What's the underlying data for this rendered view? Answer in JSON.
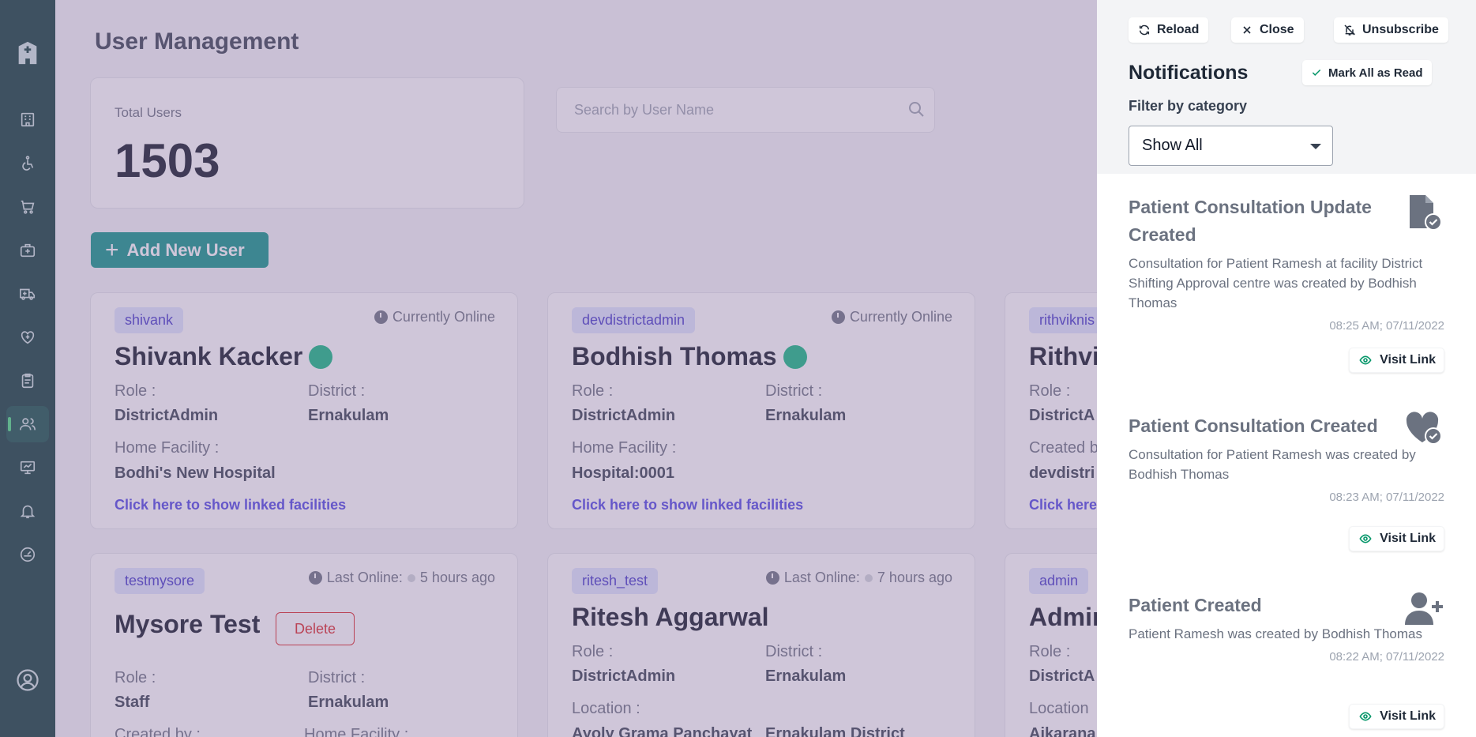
{
  "sidebar": {
    "logo": "hospital-icon",
    "items": [
      {
        "icon": "building-icon",
        "active": false
      },
      {
        "icon": "wheelchair-icon",
        "active": false
      },
      {
        "icon": "cart-icon",
        "active": false
      },
      {
        "icon": "medical-kit-icon",
        "active": false
      },
      {
        "icon": "ambulance-icon",
        "active": false
      },
      {
        "icon": "heart-plus-icon",
        "active": false
      },
      {
        "icon": "clipboard-icon",
        "active": false
      },
      {
        "icon": "users-icon",
        "active": true
      },
      {
        "icon": "monitor-icon",
        "active": false
      },
      {
        "icon": "bell-icon",
        "active": false
      },
      {
        "icon": "dashboard-icon",
        "active": false
      }
    ],
    "profile_icon": "user-circle-icon"
  },
  "main": {
    "title": "User Management",
    "total_label": "Total Users",
    "total_value": "1503",
    "search_placeholder": "Search by User Name",
    "add_button": "Add New User",
    "users": [
      {
        "username": "shivank",
        "status": "Currently Online",
        "name": "Shivank Kacker",
        "online": true,
        "role_label": "Role :",
        "role": "DistrictAdmin",
        "district_label": "District :",
        "district": "Ernakulam",
        "extra_label": "Home Facility :",
        "extra": "Bodhi's New Hospital",
        "link": "Click here to show linked facilities"
      },
      {
        "username": "devdistrictadmin",
        "status": "Currently Online",
        "name": "Bodhish Thomas",
        "online": true,
        "role_label": "Role :",
        "role": "DistrictAdmin",
        "district_label": "District :",
        "district": "Ernakulam",
        "extra_label": "Home Facility :",
        "extra": "Hospital:0001",
        "link": "Click here to show linked facilities"
      },
      {
        "username": "rithviknis",
        "name": "Rithvi",
        "role_label": "Role :",
        "role": "DistrictA",
        "extra_label": "Created b",
        "extra": "devdistri",
        "link": "Click here"
      },
      {
        "username": "testmysore",
        "status_label": "Last Online:",
        "status_time": "5 hours ago",
        "name": "Mysore Test",
        "delete_label": "Delete",
        "role_label": "Role :",
        "role": "Staff",
        "district_label": "District :",
        "district": "Ernakulam",
        "created_label": "Created by :",
        "home_label": "Home Facility :"
      },
      {
        "username": "ritesh_test",
        "status_label": "Last Online:",
        "status_time": "7 hours ago",
        "name": "Ritesh Aggarwal",
        "role_label": "Role :",
        "role": "DistrictAdmin",
        "district_label": "District :",
        "district": "Ernakulam",
        "location_label": "Location :",
        "location_a": "Ayoly  Grama Panchayat",
        "location_b": "Ernakulam District"
      },
      {
        "username": "admin",
        "name": "Admin",
        "role_label": "Role :",
        "role": "DistrictA",
        "location_label": "Location",
        "location_a": "Aikarana"
      }
    ]
  },
  "panel": {
    "reload": "Reload",
    "close": "Close",
    "unsubscribe": "Unsubscribe",
    "title": "Notifications",
    "mark_all": "Mark All as Read",
    "filter_label": "Filter by category",
    "filter_value": "Show All",
    "notifications": [
      {
        "title": "Patient Consultation Update Created",
        "body": "Consultation for Patient Ramesh at facility District Shifting Approval centre was created by Bodhish Thomas",
        "time": "08:25 AM; 07/11/2022",
        "icon": "file-check-icon",
        "visit": "Visit Link"
      },
      {
        "title": "Patient Consultation Created",
        "body": "Consultation for Patient Ramesh was created by Bodhish Thomas",
        "time": "08:23 AM; 07/11/2022",
        "icon": "heart-check-icon",
        "visit": "Visit Link"
      },
      {
        "title": "Patient Created",
        "body": "Patient Ramesh was created by Bodhish Thomas",
        "time": "08:22 AM; 07/11/2022",
        "icon": "user-plus-icon",
        "visit": "Visit Link"
      }
    ]
  },
  "colors": {
    "sidebar": "#0e3c38",
    "accent": "#0d9488",
    "overlay": "#8671a0",
    "link": "#4f46e5"
  }
}
